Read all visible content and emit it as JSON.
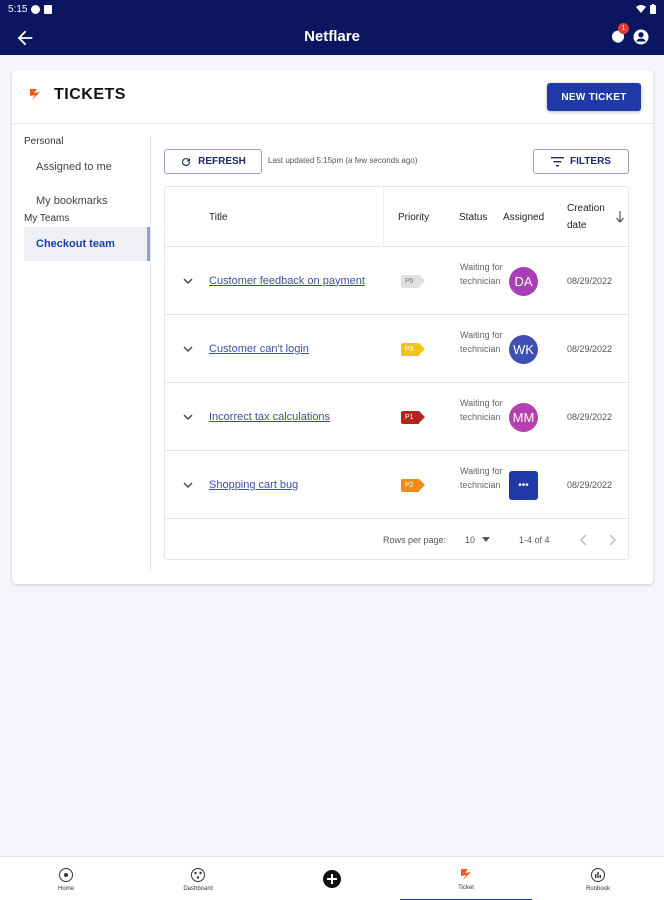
{
  "status_bar": {
    "time": "5:15"
  },
  "app_bar": {
    "title": "Netflare",
    "notification_count": "1"
  },
  "page": {
    "title": "TICKETS",
    "new_ticket_label": "NEW TICKET"
  },
  "sidebar": {
    "sections": [
      {
        "label": "Personal",
        "items": [
          {
            "label": "Assigned to me"
          },
          {
            "label": "My bookmarks"
          }
        ]
      },
      {
        "label": "My Teams",
        "items": [
          {
            "label": "Checkout team",
            "active": true
          }
        ]
      }
    ]
  },
  "toolbar": {
    "refresh_label": "REFRESH",
    "last_updated": "Last updated 5:15pm (a few seconds ago)",
    "filters_label": "FILTERS"
  },
  "table": {
    "columns": [
      {
        "label": "Title"
      },
      {
        "label": "Priority"
      },
      {
        "label": "Status"
      },
      {
        "label": "Assigned"
      },
      {
        "label": "Creation date"
      }
    ],
    "rows": [
      {
        "title": "Customer feedback on payment",
        "priority": "P5",
        "priority_color": "#e0e0e0",
        "priority_text": "#777777",
        "status": "Waiting for technician",
        "assignee": "DA",
        "assignee_color": "#a83fb5",
        "date": "08/29/2022"
      },
      {
        "title": "Customer can't login",
        "priority": "P3",
        "priority_color": "#f2c417",
        "priority_text": "#ffffff",
        "status": "Waiting for technician",
        "assignee": "WK",
        "assignee_color": "#3f4fb5",
        "date": "08/29/2022"
      },
      {
        "title": "Incorrect tax calculations",
        "priority": "P1",
        "priority_color": "#b3261e",
        "priority_text": "#ffffff",
        "status": "Waiting for technician",
        "assignee": "MM",
        "assignee_color": "#b53fb0",
        "date": "08/29/2022"
      },
      {
        "title": "Shopping cart bug",
        "priority": "P2",
        "priority_color": "#f28a17",
        "priority_text": "#ffffff",
        "status": "Waiting for technician",
        "assignee": "•••",
        "assignee_color": "#1f3aa8",
        "date": "08/29/2022"
      }
    ],
    "pagination": {
      "rows_per_page_label": "Rows per page:",
      "rows_per_page": "10",
      "range": "1-4 of 4"
    }
  },
  "bottom_nav": [
    {
      "label": "Home",
      "icon": "home-icon"
    },
    {
      "label": "Dashboard",
      "icon": "dashboard-icon"
    },
    {
      "label": "",
      "icon": "add-icon"
    },
    {
      "label": "Ticket",
      "icon": "ticket-icon",
      "active": true
    },
    {
      "label": "Runbook",
      "icon": "runbook-icon"
    }
  ]
}
